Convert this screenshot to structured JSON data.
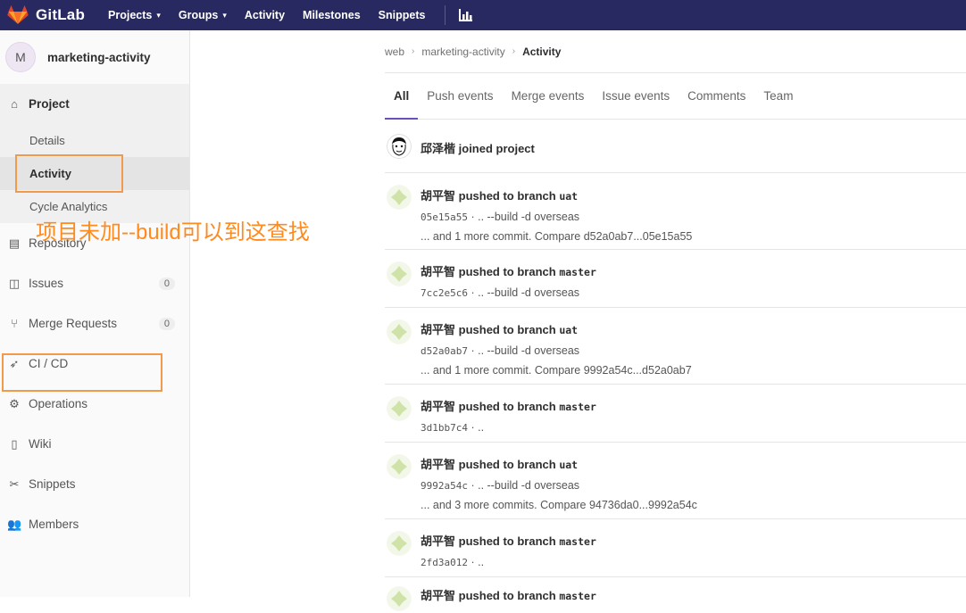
{
  "topnav": {
    "brand": "GitLab",
    "items": [
      {
        "label": "Projects",
        "caret": true
      },
      {
        "label": "Groups",
        "caret": true
      },
      {
        "label": "Activity",
        "caret": false
      },
      {
        "label": "Milestones",
        "caret": false
      },
      {
        "label": "Snippets",
        "caret": false
      }
    ],
    "chart_icon": "bar-chart-icon"
  },
  "sidebar": {
    "avatar_letter": "M",
    "project_name": "marketing-activity",
    "project_label": "Project",
    "sub_items": [
      "Details",
      "Activity",
      "Cycle Analytics"
    ],
    "items": [
      {
        "label": "Repository",
        "icon": "repository-icon"
      },
      {
        "label": "Issues",
        "icon": "issues-icon",
        "count": "0"
      },
      {
        "label": "Merge Requests",
        "icon": "merge-request-icon",
        "count": "0"
      },
      {
        "label": "CI / CD",
        "icon": "rocket-icon"
      },
      {
        "label": "Operations",
        "icon": "operations-icon"
      },
      {
        "label": "Wiki",
        "icon": "wiki-icon"
      },
      {
        "label": "Snippets",
        "icon": "snippets-icon"
      },
      {
        "label": "Members",
        "icon": "members-icon"
      }
    ]
  },
  "annotation": "项目未加--build可以到这查找",
  "breadcrumb": [
    "web",
    "marketing-activity",
    "Activity"
  ],
  "tabs": [
    "All",
    "Push events",
    "Merge events",
    "Issue events",
    "Comments",
    "Team"
  ],
  "events": [
    {
      "author": "邱泽楷",
      "action": "joined project",
      "branch": "",
      "sha": "",
      "message": "",
      "more": ""
    },
    {
      "author": "胡平智",
      "action": "pushed to branch",
      "branch": "uat",
      "sha": "05e15a55",
      "message": " · .. --build -d overseas",
      "more": "... and 1 more commit. Compare d52a0ab7...05e15a55"
    },
    {
      "author": "胡平智",
      "action": "pushed to branch",
      "branch": "master",
      "sha": "7cc2e5c6",
      "message": " · .. --build -d overseas",
      "more": ""
    },
    {
      "author": "胡平智",
      "action": "pushed to branch",
      "branch": "uat",
      "sha": "d52a0ab7",
      "message": " · .. --build -d overseas",
      "more": "... and 1 more commit. Compare 9992a54c...d52a0ab7"
    },
    {
      "author": "胡平智",
      "action": "pushed to branch",
      "branch": "master",
      "sha": "3d1bb7c4",
      "message": " · ..",
      "more": ""
    },
    {
      "author": "胡平智",
      "action": "pushed to branch",
      "branch": "uat",
      "sha": "9992a54c",
      "message": " · .. --build -d overseas",
      "more": "... and 3 more commits. Compare 94736da0...9992a54c"
    },
    {
      "author": "胡平智",
      "action": "pushed to branch",
      "branch": "master",
      "sha": "2fd3a012",
      "message": " · ..",
      "more": ""
    },
    {
      "author": "胡平智",
      "action": "pushed to branch",
      "branch": "master",
      "sha": "",
      "message": "",
      "more": ""
    }
  ],
  "colors": {
    "nav_bg": "#292961",
    "highlight": "#f29a4c",
    "annotation": "#ff8a1e",
    "tab_active": "#6b4fbb"
  }
}
